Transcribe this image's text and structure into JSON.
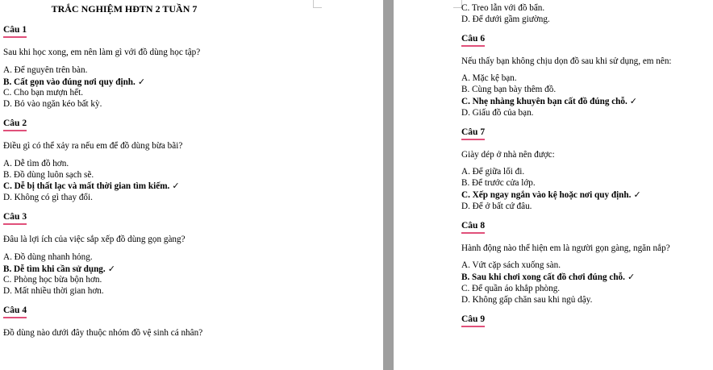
{
  "document": {
    "title": "TRẮC NGHIỆM HĐTN 2 TUẦN 7",
    "check_mark": "✓"
  },
  "left_column": {
    "questions": [
      {
        "heading": "Câu 1",
        "text": "Sau khi học xong, em nên làm gì với đồ dùng học tập?",
        "options": [
          {
            "label": "A. Để nguyên trên bàn.",
            "correct": false
          },
          {
            "label": "B. Cất gọn vào đúng nơi quy định.",
            "correct": true
          },
          {
            "label": "C. Cho bạn mượn hết.",
            "correct": false
          },
          {
            "label": "D. Bỏ vào ngăn kéo bất kỳ.",
            "correct": false
          }
        ]
      },
      {
        "heading": "Câu 2",
        "text": "Điều gì có thể xảy ra nếu em để đồ dùng bừa bãi?",
        "options": [
          {
            "label": "A. Dễ tìm đồ hơn.",
            "correct": false
          },
          {
            "label": "B. Đồ dùng luôn sạch sẽ.",
            "correct": false
          },
          {
            "label": "C. Dễ bị thất lạc và mất thời gian tìm kiếm.",
            "correct": true
          },
          {
            "label": "D. Không có gì thay đổi.",
            "correct": false
          }
        ]
      },
      {
        "heading": "Câu 3",
        "text": "Đâu là lợi ích của việc sắp xếp đồ dùng gọn gàng?",
        "options": [
          {
            "label": "A. Đồ dùng nhanh hỏng.",
            "correct": false
          },
          {
            "label": "B. Dễ tìm khi cần sử dụng.",
            "correct": true
          },
          {
            "label": "C. Phòng học bừa bộn hơn.",
            "correct": false
          },
          {
            "label": "D. Mất nhiều thời gian hơn.",
            "correct": false
          }
        ]
      },
      {
        "heading": "Câu 4",
        "text": "Đồ dùng nào dưới đây thuộc nhóm đồ vệ sinh cá nhân?",
        "options": []
      }
    ]
  },
  "right_column": {
    "carryover_options": [
      {
        "label": "C. Treo lẫn với đồ bẩn.",
        "correct": false
      },
      {
        "label": "D. Để dưới gầm giường.",
        "correct": false
      }
    ],
    "questions": [
      {
        "heading": "Câu 6",
        "text": "Nếu thấy bạn không chịu dọn đồ sau khi sử dụng, em nên:",
        "options": [
          {
            "label": "A. Mặc kệ bạn.",
            "correct": false
          },
          {
            "label": "B. Cùng bạn bày thêm đồ.",
            "correct": false
          },
          {
            "label": "C. Nhẹ nhàng khuyên bạn cất đồ đúng chỗ.",
            "correct": true
          },
          {
            "label": "D. Giấu đồ của bạn.",
            "correct": false
          }
        ]
      },
      {
        "heading": "Câu 7",
        "text": "Giày dép ở nhà nên được:",
        "options": [
          {
            "label": "A. Để giữa lối đi.",
            "correct": false
          },
          {
            "label": "B. Để trước cửa lớp.",
            "correct": false
          },
          {
            "label": "C. Xếp ngay ngắn vào kệ hoặc nơi quy định.",
            "correct": true
          },
          {
            "label": "D. Để ở bất cứ đâu.",
            "correct": false
          }
        ]
      },
      {
        "heading": "Câu 8",
        "text": "Hành động nào thể hiện em là người gọn gàng, ngăn nắp?",
        "options": [
          {
            "label": "A. Vứt cặp sách xuống sàn.",
            "correct": false
          },
          {
            "label": "B. Sau khi chơi xong cất đồ chơi đúng chỗ.",
            "correct": true
          },
          {
            "label": "C. Để quần áo khắp phòng.",
            "correct": false
          },
          {
            "label": "D. Không gấp chăn sau khi ngủ dậy.",
            "correct": false
          }
        ]
      },
      {
        "heading": "Câu 9",
        "text": "",
        "options": []
      }
    ]
  }
}
